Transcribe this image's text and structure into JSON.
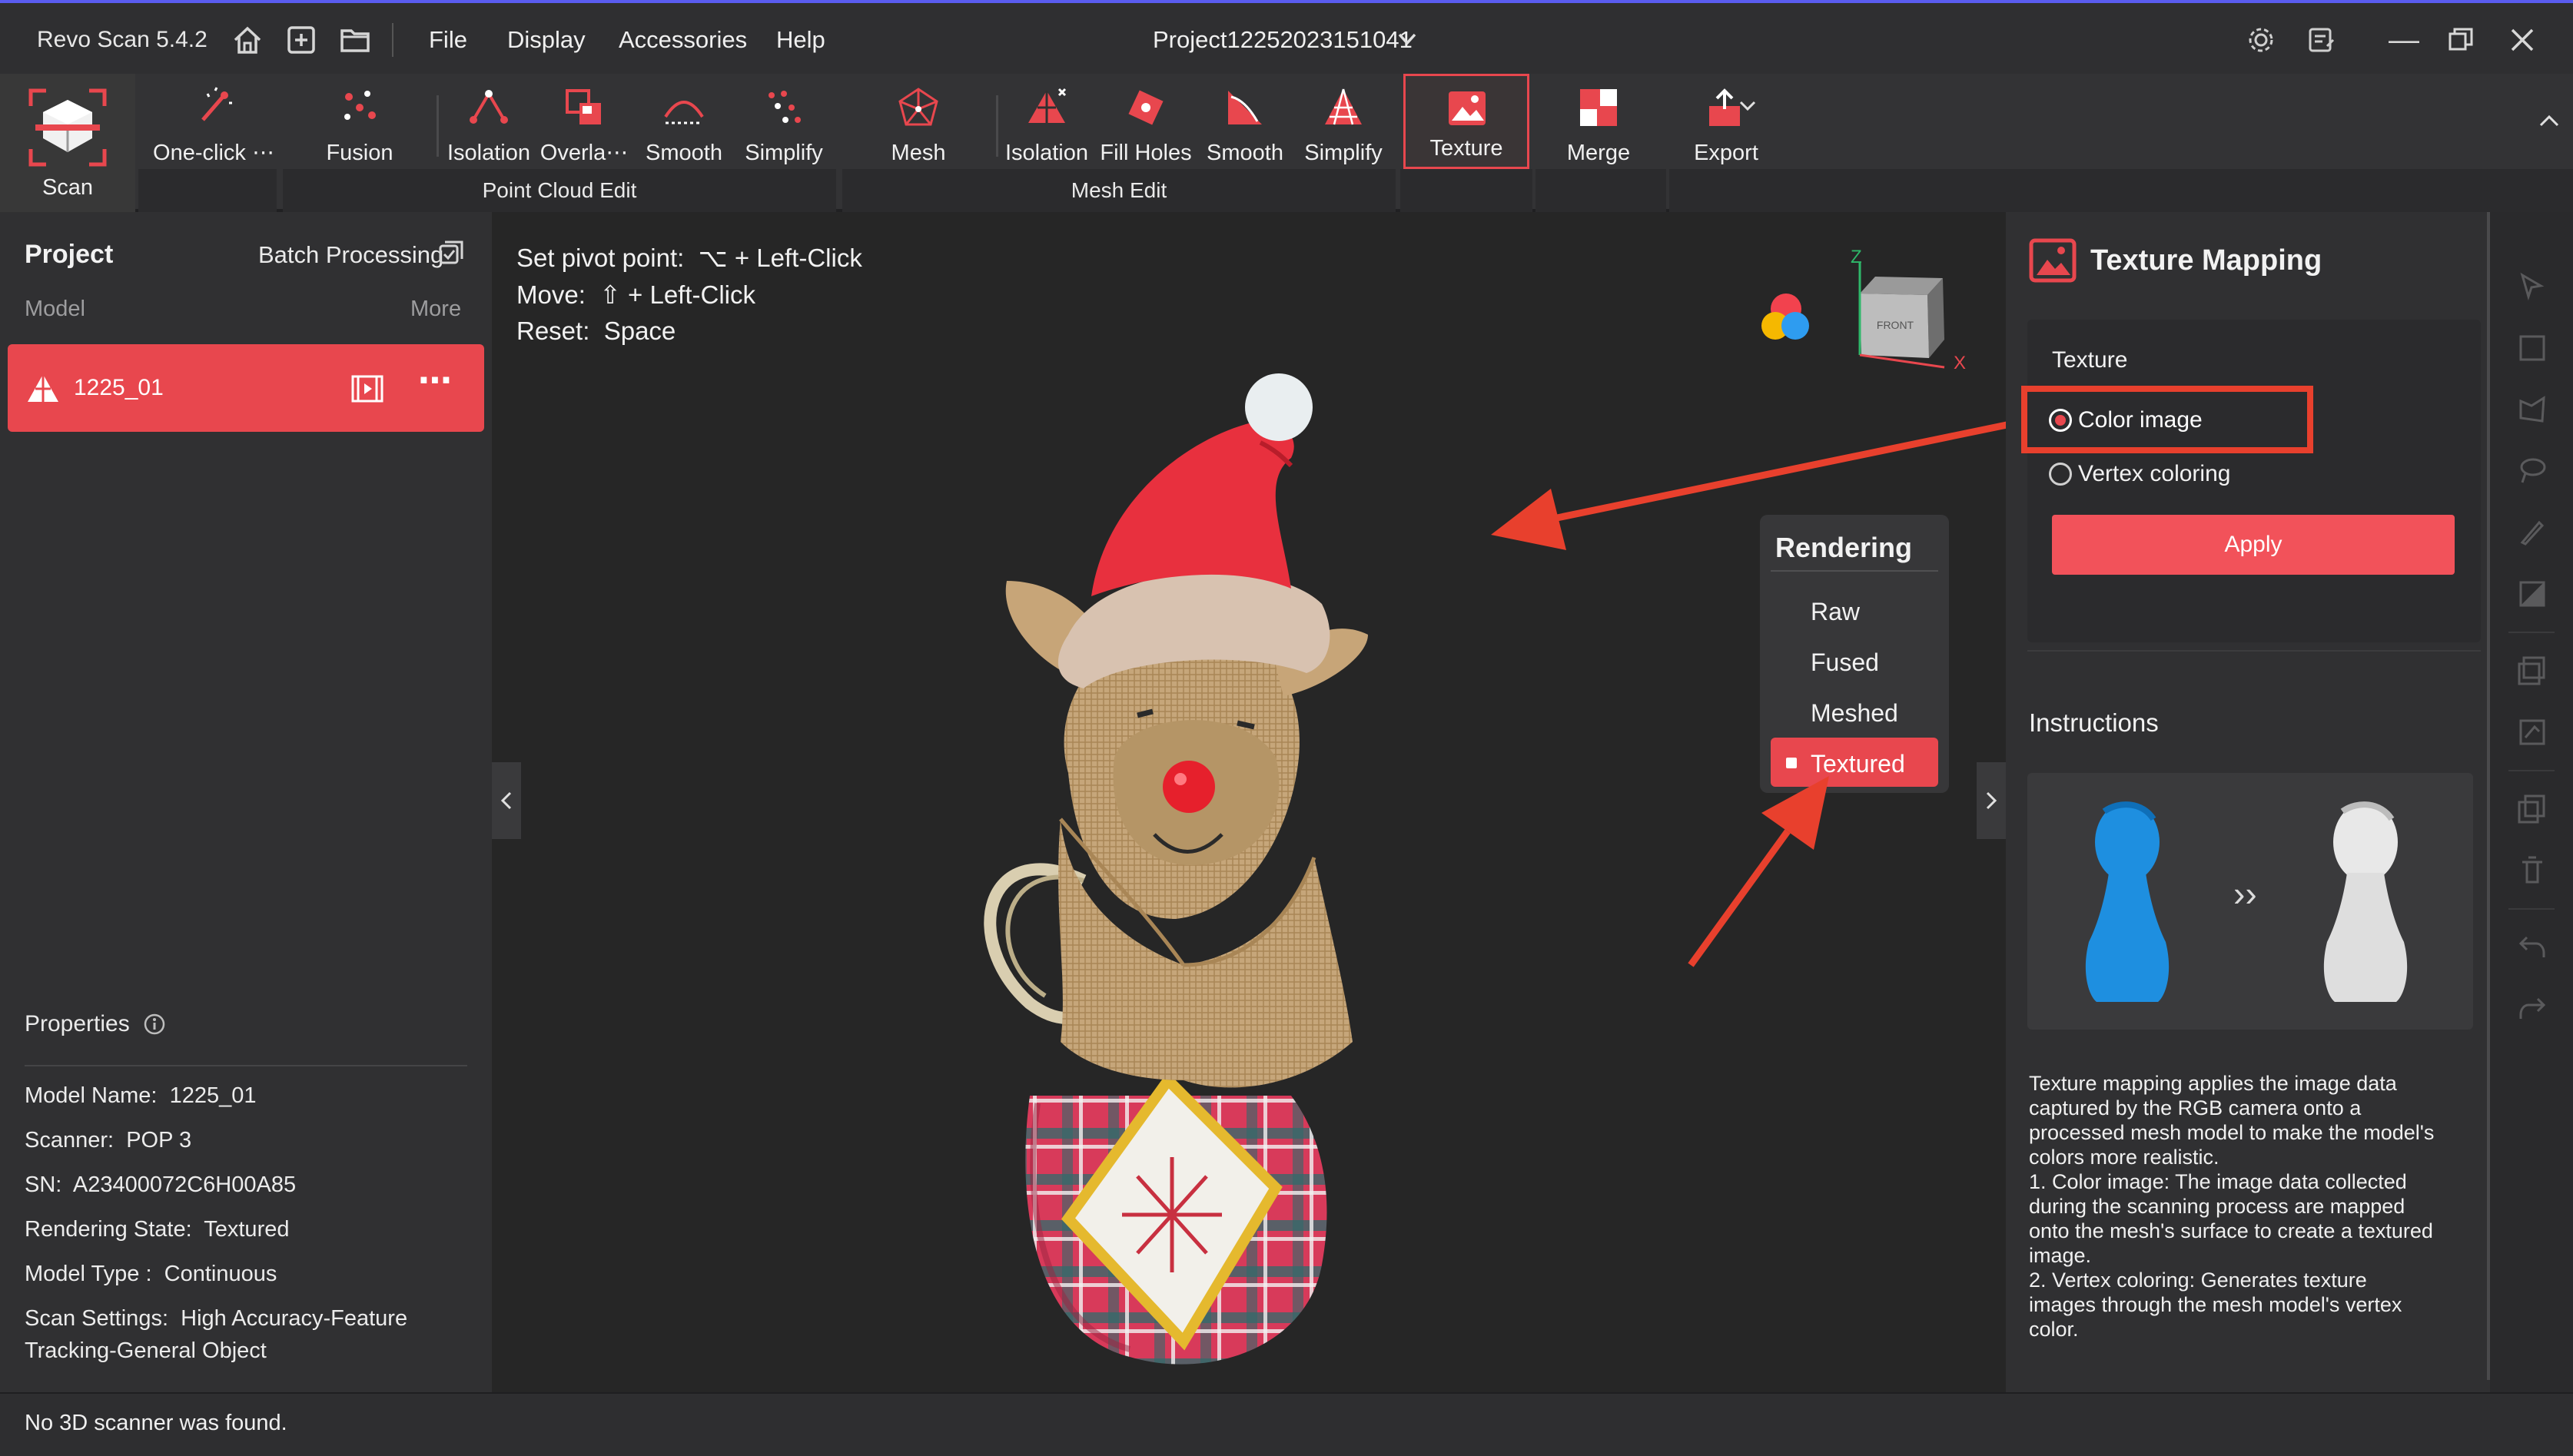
{
  "app": {
    "title": "Revo Scan 5.4.2",
    "project_name": "Project12252023151041"
  },
  "menu": [
    "File",
    "Display",
    "Accessories",
    "Help"
  ],
  "ribbon": {
    "scan": "Scan",
    "one_click": "One-click ⋯",
    "fusion": "Fusion",
    "pc_isolation": "Isolation",
    "pc_overlap": "Overla⋯",
    "pc_smooth": "Smooth",
    "pc_simplify": "Simplify",
    "mesh": "Mesh",
    "me_isolation": "Isolation",
    "me_fill": "Fill Holes",
    "me_smooth": "Smooth",
    "me_simplify": "Simplify",
    "texture": "Texture",
    "merge": "Merge",
    "export": "Export",
    "group_point_cloud": "Point Cloud Edit",
    "group_mesh": "Mesh Edit"
  },
  "left": {
    "project": "Project",
    "batch": "Batch Processing",
    "model": "Model",
    "more": "More",
    "model_item": "1225_01",
    "properties": "Properties",
    "props": [
      {
        "k": "Model Name:",
        "v": "1225_01"
      },
      {
        "k": "Scanner:",
        "v": "POP 3"
      },
      {
        "k": "SN:",
        "v": "A23400072C6H00A85"
      },
      {
        "k": "Rendering State:",
        "v": "Textured"
      },
      {
        "k": "Model Type :",
        "v": "Continuous"
      },
      {
        "k": "Scan Settings:",
        "v": "High Accuracy-Feature"
      }
    ],
    "scan_settings_line2": "Tracking-General Object"
  },
  "viewport": {
    "pivot_label": "Set pivot point:",
    "pivot_keys": "⌥ + Left-Click",
    "move_label": "Move:",
    "move_keys": "⇧ + Left-Click",
    "reset_label": "Reset:",
    "reset_keys": "Space",
    "axis_z": "Z",
    "axis_x": "X",
    "cube_face": "FRONT",
    "rendering_title": "Rendering",
    "rendering_options": [
      "Raw",
      "Fused",
      "Meshed",
      "Textured"
    ],
    "rendering_selected": "Textured"
  },
  "right": {
    "title": "Texture Mapping",
    "texture_label": "Texture",
    "option_color": "Color image",
    "option_vertex": "Vertex coloring",
    "apply": "Apply",
    "instructions": "Instructions",
    "instr_lines": [
      "Texture mapping applies the image data",
      "captured by the RGB camera onto a",
      "processed mesh model to make the model's",
      "colors more realistic.",
      "1. Color image: The image data collected",
      "during the scanning process are mapped",
      "onto the mesh's surface to create a textured",
      "image.",
      "2. Vertex coloring: Generates texture",
      "images through the mesh model's vertex",
      "color."
    ]
  },
  "status": {
    "message": "No 3D scanner was found."
  },
  "colors": {
    "accent": "#e8474e",
    "annotation": "#e8402d"
  }
}
